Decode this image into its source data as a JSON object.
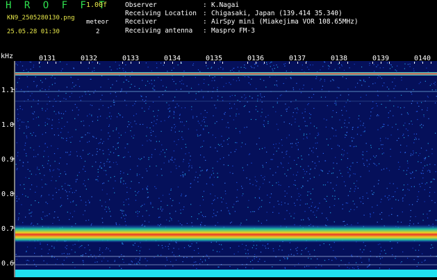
{
  "header": {
    "app_title": "H R O F F T",
    "version": "1.00f",
    "filename": "KN9_2505280130.png",
    "mode_label": "meteor",
    "datetime": "25.05.28 01:30",
    "mode_value": "2"
  },
  "info": [
    {
      "label": "Observer",
      "value": "K.Nagai"
    },
    {
      "label": "Receiving Location",
      "value": "Chigasaki, Japan (139.414 35.340)"
    },
    {
      "label": "Receiver",
      "value": "AirSpy mini (Miakejima VOR 108.65MHz)"
    },
    {
      "label": "Receiving antenna",
      "value": "Maspro FM-3"
    }
  ],
  "spectrogram": {
    "y_unit": "kHz",
    "y_ticks": [
      "1.1",
      "1.0",
      "0.9",
      "0.8",
      "0.7",
      "0.6"
    ],
    "time_labels": [
      "0131",
      "0132",
      "0133",
      "0134",
      "0135",
      "0136",
      "0137",
      "0138",
      "0139",
      "0140"
    ],
    "colors": {
      "background": "#05105a",
      "noise": "#1c4fe0",
      "band_hot": "#e8382a",
      "band_warm": "#f0d020",
      "baseline": "#20e0f0"
    }
  }
}
